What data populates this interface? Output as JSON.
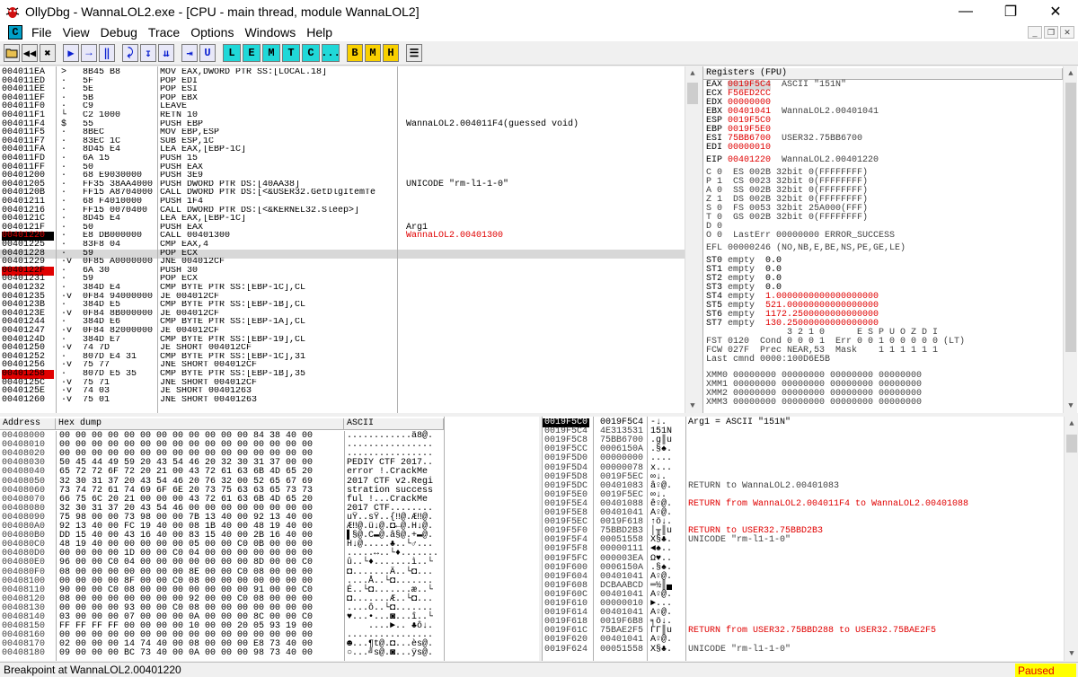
{
  "window": {
    "title": "OllyDbg - WannaLOL2.exe - [CPU - main thread, module WannaLOL2]"
  },
  "menu": [
    "File",
    "View",
    "Debug",
    "Trace",
    "Options",
    "Windows",
    "Help"
  ],
  "toolbar": {
    "letters": [
      "L",
      "E",
      "M",
      "T",
      "C",
      "...",
      "B",
      "M",
      "H"
    ]
  },
  "colors": {
    "selected": "#000000",
    "breakpoint": "#e00000",
    "highlight": "#e00000",
    "paused_bg": "#ffff00"
  },
  "disasm": [
    {
      "a": "004011EA",
      "b": "> ",
      "h": "8B45 B8",
      "d": "MOV EAX,DWORD PTR SS:[LOCAL.18]",
      "c": ""
    },
    {
      "a": "004011ED",
      "b": "· ",
      "h": "5F",
      "d": "POP EDI",
      "c": ""
    },
    {
      "a": "004011EE",
      "b": "· ",
      "h": "5E",
      "d": "POP ESI",
      "c": ""
    },
    {
      "a": "004011EF",
      "b": "· ",
      "h": "5B",
      "d": "POP EBX",
      "c": ""
    },
    {
      "a": "004011F0",
      "b": "· ",
      "h": "C9",
      "d": "LEAVE",
      "c": ""
    },
    {
      "a": "004011F1",
      "b": "└ ",
      "h": "C2 1000",
      "d": "RETN 10",
      "c": ""
    },
    {
      "a": "004011F4",
      "b": "$ ",
      "h": "55",
      "d": "PUSH EBP",
      "c": "WannaLOL2.004011F4(guessed void)"
    },
    {
      "a": "004011F5",
      "b": "· ",
      "h": "8BEC",
      "d": "MOV EBP,ESP",
      "c": ""
    },
    {
      "a": "004011F7",
      "b": "· ",
      "h": "83EC 1C",
      "d": "SUB ESP,1C",
      "c": ""
    },
    {
      "a": "004011FA",
      "b": "· ",
      "h": "8D45 E4",
      "d": "LEA EAX,[EBP-1C]",
      "c": ""
    },
    {
      "a": "004011FD",
      "b": "· ",
      "h": "6A 15",
      "d": "PUSH 15",
      "c": ""
    },
    {
      "a": "004011FF",
      "b": "· ",
      "h": "50",
      "d": "PUSH EAX",
      "c": ""
    },
    {
      "a": "00401200",
      "b": "· ",
      "h": "68 E9030000",
      "d": "PUSH 3E9",
      "c": ""
    },
    {
      "a": "00401205",
      "b": "· ",
      "h": "FF35 38AA4000",
      "d": "PUSH DWORD PTR DS:[40AA38]",
      "c": "UNICODE \"rm-l1-1-0\""
    },
    {
      "a": "0040120B",
      "b": "· ",
      "h": "FF15 A8704000",
      "d": "CALL DWORD PTR DS:[<&USER32.GetDlgItemTe",
      "c": ""
    },
    {
      "a": "00401211",
      "b": "· ",
      "h": "68 F4010000",
      "d": "PUSH 1F4",
      "c": ""
    },
    {
      "a": "00401216",
      "b": "· ",
      "h": "FF15 0070400",
      "d": "CALL DWORD PTR DS:[<&KERNEL32.Sleep>]",
      "c": ""
    },
    {
      "a": "0040121C",
      "b": "· ",
      "h": "8D45 E4",
      "d": "LEA EAX,[EBP-1C]",
      "c": ""
    },
    {
      "a": "0040121F",
      "b": "· ",
      "h": "50",
      "d": "PUSH EAX",
      "c": "Arg1"
    },
    {
      "a": "00401220",
      "b": "· ",
      "h": "E8 DB000000",
      "d": "CALL 00401300",
      "c": "WannaLOL2.00401300"
    },
    {
      "a": "00401225",
      "b": "· ",
      "h": "83F8 04",
      "d": "CMP EAX,4",
      "c": ""
    },
    {
      "a": "00401228",
      "b": "· ",
      "h": "59",
      "d": "POP ECX",
      "c": ""
    },
    {
      "a": "00401229",
      "b": "·v",
      "h": "0F85 A0000000",
      "d": "JNE 004012CF",
      "c": ""
    },
    {
      "a": "0040122F",
      "b": "· ",
      "h": "6A 30",
      "d": "PUSH 30",
      "c": ""
    },
    {
      "a": "00401231",
      "b": "· ",
      "h": "59",
      "d": "POP ECX",
      "c": ""
    },
    {
      "a": "00401232",
      "b": "· ",
      "h": "384D E4",
      "d": "CMP BYTE PTR SS:[EBP-1C],CL",
      "c": ""
    },
    {
      "a": "00401235",
      "b": "·v",
      "h": "0F84 94000000",
      "d": "JE 004012CF",
      "c": ""
    },
    {
      "a": "0040123B",
      "b": "· ",
      "h": "384D E5",
      "d": "CMP BYTE PTR SS:[EBP-1B],CL",
      "c": ""
    },
    {
      "a": "0040123E",
      "b": "·v",
      "h": "0F84 8B000000",
      "d": "JE 004012CF",
      "c": ""
    },
    {
      "a": "00401244",
      "b": "· ",
      "h": "384D E6",
      "d": "CMP BYTE PTR SS:[EBP-1A],CL",
      "c": ""
    },
    {
      "a": "00401247",
      "b": "·v",
      "h": "0F84 82000000",
      "d": "JE 004012CF",
      "c": ""
    },
    {
      "a": "0040124D",
      "b": "· ",
      "h": "384D E7",
      "d": "CMP BYTE PTR SS:[EBP-19],CL",
      "c": ""
    },
    {
      "a": "00401250",
      "b": "·v",
      "h": "74 7D",
      "d": "JE SHORT 004012CF",
      "c": ""
    },
    {
      "a": "00401252",
      "b": "· ",
      "h": "807D E4 31",
      "d": "CMP BYTE PTR SS:[EBP-1C],31",
      "c": ""
    },
    {
      "a": "00401256",
      "b": "·v",
      "h": "75 77",
      "d": "JNE SHORT 004012CF",
      "c": ""
    },
    {
      "a": "00401258",
      "b": "· ",
      "h": "807D E5 35",
      "d": "CMP BYTE PTR SS:[EBP-1B],35",
      "c": ""
    },
    {
      "a": "0040125C",
      "b": "·v",
      "h": "75 71",
      "d": "JNE SHORT 004012CF",
      "c": ""
    },
    {
      "a": "0040125E",
      "b": "·v",
      "h": "74 03",
      "d": "JE SHORT 00401263",
      "c": ""
    },
    {
      "a": "00401260",
      "b": "·v",
      "h": "75 01",
      "d": "JNE SHORT 00401263",
      "c": ""
    }
  ],
  "registers": {
    "title": "Registers (FPU)",
    "gp": [
      {
        "n": "EAX",
        "v": "0019F5C4",
        "c": "ASCII \"151N\"",
        "red": true
      },
      {
        "n": "ECX",
        "v": "F56ED2CC",
        "c": "",
        "red": true
      },
      {
        "n": "EDX",
        "v": "00000000",
        "c": "",
        "red": true
      },
      {
        "n": "EBX",
        "v": "00401041",
        "c": "WannaLOL2.00401041",
        "red": true
      },
      {
        "n": "ESP",
        "v": "0019F5C0",
        "c": "",
        "red": true
      },
      {
        "n": "EBP",
        "v": "0019F5E0",
        "c": "",
        "red": true
      },
      {
        "n": "ESI",
        "v": "75BB6700",
        "c": "USER32.75BB6700",
        "red": true
      },
      {
        "n": "EDI",
        "v": "00000010",
        "c": "",
        "red": true
      }
    ],
    "eip": {
      "n": "EIP",
      "v": "00401220",
      "c": "WannaLOL2.00401220"
    },
    "flags": [
      "C 0  ES 002B 32bit 0(FFFFFFFF)",
      "P 1  CS 0023 32bit 0(FFFFFFFF)",
      "A 0  SS 002B 32bit 0(FFFFFFFF)",
      "Z 1  DS 002B 32bit 0(FFFFFFFF)",
      "S 0  FS 0053 32bit 25A000(FFF)",
      "T 0  GS 002B 32bit 0(FFFFFFFF)",
      "D 0",
      "O 0  LastErr 00000000 ERROR_SUCCESS"
    ],
    "efl": "EFL 00000246 (NO,NB,E,BE,NS,PE,GE,LE)",
    "st": [
      {
        "n": "ST0",
        "t": "empty",
        "v": "0.0",
        "red": false
      },
      {
        "n": "ST1",
        "t": "empty",
        "v": "0.0",
        "red": false
      },
      {
        "n": "ST2",
        "t": "empty",
        "v": "0.0",
        "red": false
      },
      {
        "n": "ST3",
        "t": "empty",
        "v": "0.0",
        "red": false
      },
      {
        "n": "ST4",
        "t": "empty",
        "v": "1.0000000000000000000",
        "red": true
      },
      {
        "n": "ST5",
        "t": "empty",
        "v": "521.00000000000000000",
        "red": true
      },
      {
        "n": "ST6",
        "t": "empty",
        "v": "1172.2500000000000000",
        "red": true
      },
      {
        "n": "ST7",
        "t": "empty",
        "v": "130.25000000000000000",
        "red": true
      }
    ],
    "fpu": [
      "               3 2 1 0      E S P U O Z D I",
      "FST 0120  Cond 0 0 0 1  Err 0 0 1 0 0 0 0 0 (LT)",
      "FCW 027F  Prec NEAR,53  Mask    1 1 1 1 1 1",
      "Last cmnd 0000:100D6E5B"
    ],
    "xmm": [
      "XMM0 00000000 00000000 00000000 00000000",
      "XMM1 00000000 00000000 00000000 00000000",
      "XMM2 00000000 00000000 00000000 00000000",
      "XMM3 00000000 00000000 00000000 00000000"
    ]
  },
  "dump": {
    "headers": {
      "address": "Address",
      "hex": "Hex dump",
      "ascii": "ASCII"
    },
    "rows": [
      {
        "a": "00408000",
        "h": "00 00 00 00 00 00 00 00 00 00 00 00 84 38 40 00",
        "s": "............ä8@."
      },
      {
        "a": "00408010",
        "h": "00 00 00 00 00 00 00 00 00 00 00 00 00 00 00 00",
        "s": "................"
      },
      {
        "a": "00408020",
        "h": "00 00 00 00 00 00 00 00 00 00 00 00 00 00 00 00",
        "s": "................"
      },
      {
        "a": "00408030",
        "h": "50 45 44 49 59 20 43 54 46 20 32 30 31 37 00 00",
        "s": "PEDIY CTF 2017.."
      },
      {
        "a": "00408040",
        "h": "65 72 72 6F 72 20 21 00 43 72 61 63 6B 4D 65 20",
        "s": "error !.CrackMe "
      },
      {
        "a": "00408050",
        "h": "32 30 31 37 20 43 54 46 20 76 32 00 52 65 67 69",
        "s": "2017 CTF v2.Regi"
      },
      {
        "a": "00408060",
        "h": "73 74 72 61 74 69 6F 6E 20 73 75 63 63 65 73 73",
        "s": "stration success"
      },
      {
        "a": "00408070",
        "h": "66 75 6C 20 21 00 00 00 43 72 61 63 6B 4D 65 20",
        "s": "ful !...CrackMe "
      },
      {
        "a": "00408080",
        "h": "32 30 31 37 20 43 54 46 00 00 00 00 00 00 00 00",
        "s": "2017 CTF........"
      },
      {
        "a": "00408090",
        "h": "75 98 00 00 73 98 00 00 7B 13 40 00 92 13 40 00",
        "s": "uŸ..sŸ..{‼@.Æ‼@."
      },
      {
        "a": "004080A0",
        "h": "92 13 40 00 FC 19 40 00 08 1B 40 00 48 19 40 00",
        "s": "Æ‼@.ü↓@.◘←@.H↓@."
      },
      {
        "a": "004080B0",
        "h": "DD 15 40 00 43 16 40 00 83 15 40 00 2B 16 40 00",
        "s": "▌§@.C▬@.â§@.+▬@."
      },
      {
        "a": "004080C0",
        "h": "48 19 40 00 00 00 00 00 05 00 00 C0 0B 00 00 00",
        "s": "H↓@.....♣..└♂..."
      },
      {
        "a": "004080D0",
        "h": "00 00 00 00 1D 00 00 C0 04 00 00 00 00 00 00 00",
        "s": ".....↔..└♦......."
      },
      {
        "a": "004080E0",
        "h": "96 00 00 C0 04 00 00 00 00 00 00 00 8D 00 00 C0",
        "s": "û..└♦.......ì..└"
      },
      {
        "a": "004080F0",
        "h": "08 00 00 00 00 00 00 00 8E 00 00 C0 08 00 00 00",
        "s": "◘.......Ä..└◘..."
      },
      {
        "a": "00408100",
        "h": "00 00 00 00 8F 00 00 C0 08 00 00 00 00 00 00 00",
        "s": "....Å..└◘......."
      },
      {
        "a": "00408110",
        "h": "90 00 00 C0 08 00 00 00 00 00 00 00 91 00 00 C0",
        "s": "É..└◘.......æ..└"
      },
      {
        "a": "00408120",
        "h": "08 00 00 00 00 00 00 00 92 00 00 C0 08 00 00 00",
        "s": "◘.......Æ..└◘..."
      },
      {
        "a": "00408130",
        "h": "00 00 00 00 93 00 00 C0 08 00 00 00 00 00 00 00",
        "s": "....ô..└◘......."
      },
      {
        "a": "00408140",
        "h": "03 00 00 00 07 00 00 00 0A 00 00 00 8C 00 00 C0",
        "s": "♥...•...◙...î..└"
      },
      {
        "a": "00408150",
        "h": "FF FF FF FF 00 00 00 00 10 00 00 20 05 93 19 00",
        "s": "    ....►.. ♣ô↓."
      },
      {
        "a": "00408160",
        "h": "00 00 00 00 00 00 00 00 00 00 00 00 00 00 00 00",
        "s": "................"
      },
      {
        "a": "00408170",
        "h": "02 00 00 00 14 74 40 00 08 00 00 00 E8 73 40 00",
        "s": "☻...¶t@.◘...ès@."
      },
      {
        "a": "00408180",
        "h": "09 00 00 00 BC 73 40 00 0A 00 00 00 98 73 40 00",
        "s": "○...╝s@.◙...ÿs@."
      }
    ]
  },
  "stack": {
    "header": {
      "addr": "0019F5C0",
      "val": "0019F5C4",
      "asc": "-↓.",
      "cmt": "Arg1 = ASCII \"151N\""
    },
    "rows": [
      {
        "a": "0019F5C4",
        "v": "4E313531",
        "s": "151N",
        "c": "",
        "r": false
      },
      {
        "a": "0019F5C8",
        "v": "75BB6700",
        "s": ".g║u",
        "c": "",
        "r": false
      },
      {
        "a": "0019F5CC",
        "v": "0006150A",
        "s": ".§♠.",
        "c": "",
        "r": false
      },
      {
        "a": "0019F5D0",
        "v": "00000000",
        "s": "....",
        "c": "",
        "r": false
      },
      {
        "a": "0019F5D4",
        "v": "00000078",
        "s": "x...",
        "c": "",
        "r": false
      },
      {
        "a": "0019F5D8",
        "v": "0019F5EC",
        "s": "∞↓.",
        "c": "",
        "r": false
      },
      {
        "a": "0019F5DC",
        "v": "00401083",
        "s": "â♀@.",
        "c": "RETURN to WannaLOL2.00401083",
        "r": false
      },
      {
        "a": "0019F5E0",
        "v": "0019F5EC",
        "s": "∞↓.",
        "c": "",
        "r": false
      },
      {
        "a": "0019F5E4",
        "v": "00401088",
        "s": "ê♀@.",
        "c": "RETURN from WannaLOL2.004011F4 to WannaLOL2.00401088",
        "r": true
      },
      {
        "a": "0019F5E8",
        "v": "00401041",
        "s": "A♀@.",
        "c": "",
        "r": false
      },
      {
        "a": "0019F5EC",
        "v": "0019F618",
        "s": "↑ö↓.",
        "c": "",
        "r": false
      },
      {
        "a": "0019F5F0",
        "v": "75BBD2B3",
        "s": "│╥║u",
        "c": "RETURN to USER32.75BBD2B3",
        "r": true
      },
      {
        "a": "0019F5F4",
        "v": "00051558",
        "s": "X§♣.",
        "c": "UNICODE \"rm-l1-1-0\"",
        "r": false
      },
      {
        "a": "0019F5F8",
        "v": "00000111",
        "s": "◄♠..",
        "c": "",
        "r": false
      },
      {
        "a": "0019F5FC",
        "v": "000003EA",
        "s": "Ω♥..",
        "c": "",
        "r": false
      },
      {
        "a": "0019F600",
        "v": "0006150A",
        "s": ".§♠.",
        "c": "",
        "r": false
      },
      {
        "a": "0019F604",
        "v": "00401041",
        "s": "A♀@.",
        "c": "",
        "r": false
      },
      {
        "a": "0019F608",
        "v": "DCBAABCD",
        "s": "═½║▄",
        "c": "",
        "r": false
      },
      {
        "a": "0019F60C",
        "v": "00401041",
        "s": "A♀@.",
        "c": "",
        "r": false
      },
      {
        "a": "0019F610",
        "v": "00000010",
        "s": "►...",
        "c": "",
        "r": false
      },
      {
        "a": "0019F614",
        "v": "00401041",
        "s": "A♀@.",
        "c": "",
        "r": false
      },
      {
        "a": "0019F618",
        "v": "0019F6B8",
        "s": "╕ö↓.",
        "c": "",
        "r": false
      },
      {
        "a": "0019F61C",
        "v": "75BAE2F5",
        "s": "ΓΓ║u",
        "c": "RETURN from USER32.75BBD288 to USER32.75BAE2F5",
        "r": true
      },
      {
        "a": "0019F620",
        "v": "00401041",
        "s": "A♀@.",
        "c": "",
        "r": false
      },
      {
        "a": "0019F624",
        "v": "00051558",
        "s": "X§♣.",
        "c": "UNICODE \"rm-l1-1-0\"",
        "r": false
      }
    ]
  },
  "status": {
    "text": "Breakpoint at WannaLOL2.00401220",
    "state": "Paused"
  }
}
